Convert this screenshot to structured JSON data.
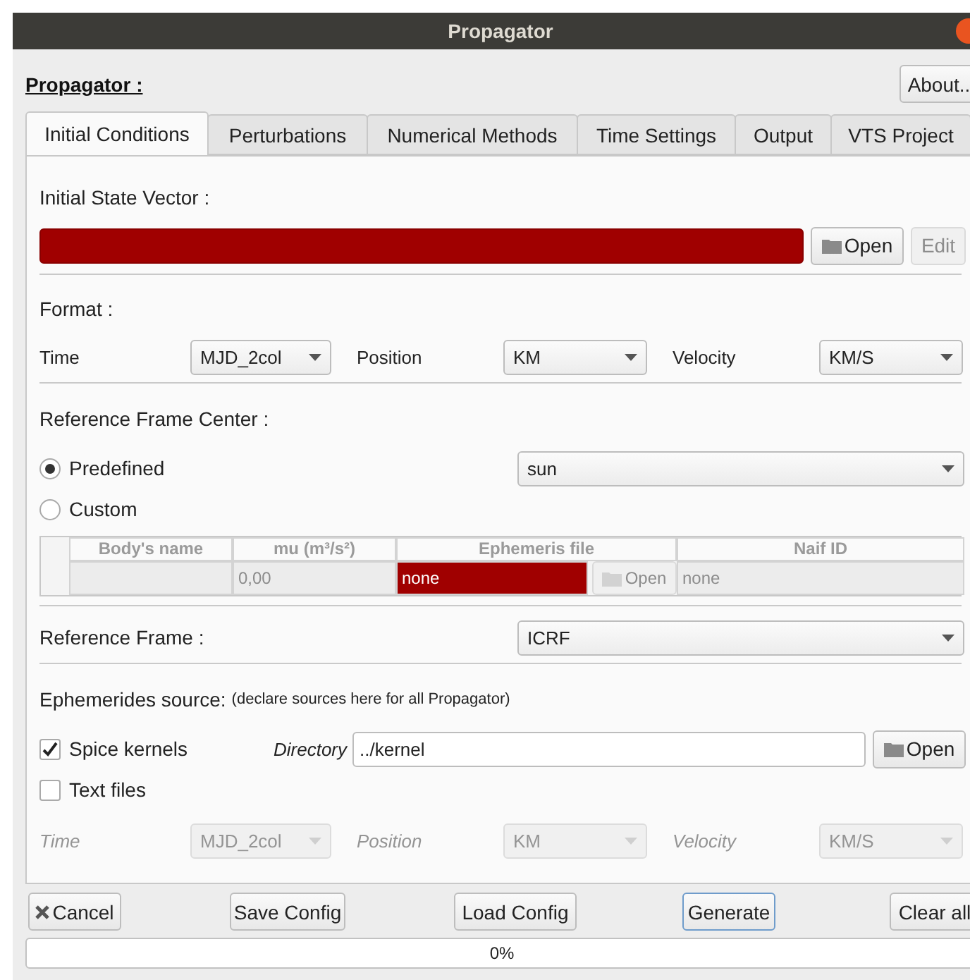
{
  "window": {
    "title": "Propagator"
  },
  "header": {
    "title": "Propagator :",
    "about_button": "About.."
  },
  "tabs": [
    {
      "label": "Initial Conditions",
      "selected": true
    },
    {
      "label": "Perturbations",
      "selected": false
    },
    {
      "label": "Numerical Methods",
      "selected": false
    },
    {
      "label": "Time Settings",
      "selected": false
    },
    {
      "label": "Output",
      "selected": false
    },
    {
      "label": "VTS Project",
      "selected": false
    }
  ],
  "initial_state": {
    "label": "Initial State Vector :",
    "file": {
      "invalid": true
    },
    "open_button": {
      "label": "Open",
      "disabled": false
    },
    "edit_button": {
      "label": "Edit",
      "disabled": true
    }
  },
  "format": {
    "label": "Format :",
    "fields": [
      {
        "label": "Time",
        "value": "MJD_2col",
        "disabled": false
      },
      {
        "label": "Position",
        "value": "KM",
        "disabled": false
      },
      {
        "label": "Velocity",
        "value": "KM/S",
        "disabled": false
      }
    ]
  },
  "reference_frame_center": {
    "label": "Reference Frame Center :",
    "options": [
      {
        "label": "Predefined",
        "selected": true
      },
      {
        "label": "Custom",
        "selected": false
      }
    ],
    "predefined_value": "sun",
    "custom_table": {
      "disabled": true,
      "columns": [
        "Body's name",
        "mu (m³/s²)",
        "Ephemeris file",
        "Naif ID"
      ],
      "row": {
        "mu": "0,00",
        "ephemeris_file": "none",
        "ephemeris_invalid": true,
        "open_button": "Open",
        "naif_id": "none"
      }
    }
  },
  "reference_frame": {
    "label": "Reference Frame :",
    "value": "ICRF"
  },
  "ephemerides": {
    "label": "Ephemerides source:",
    "note": "(declare sources here for all Propagator)",
    "sources": [
      {
        "kind": "directory",
        "label": "Spice kernels",
        "checked": true,
        "directory_label": "Directory",
        "directory": "../kernel",
        "open_button": "Open"
      },
      {
        "kind": "format",
        "label": "Text files",
        "checked": false,
        "fields": [
          {
            "label": "Time",
            "value": "MJD_2col",
            "disabled": true
          },
          {
            "label": "Position",
            "value": "KM",
            "disabled": true
          },
          {
            "label": "Velocity",
            "value": "KM/S",
            "disabled": true
          }
        ]
      }
    ]
  },
  "buttons": [
    {
      "kind": "cancel",
      "label": "Cancel",
      "focused": false
    },
    {
      "kind": "plain",
      "label": "Save Config",
      "focused": false
    },
    {
      "kind": "plain",
      "label": "Load Config",
      "focused": false
    },
    {
      "kind": "plain",
      "label": "Generate",
      "focused": true
    },
    {
      "kind": "plain",
      "label": "Clear all",
      "focused": false
    }
  ],
  "progress": {
    "level": 0,
    "reading": "0%"
  }
}
